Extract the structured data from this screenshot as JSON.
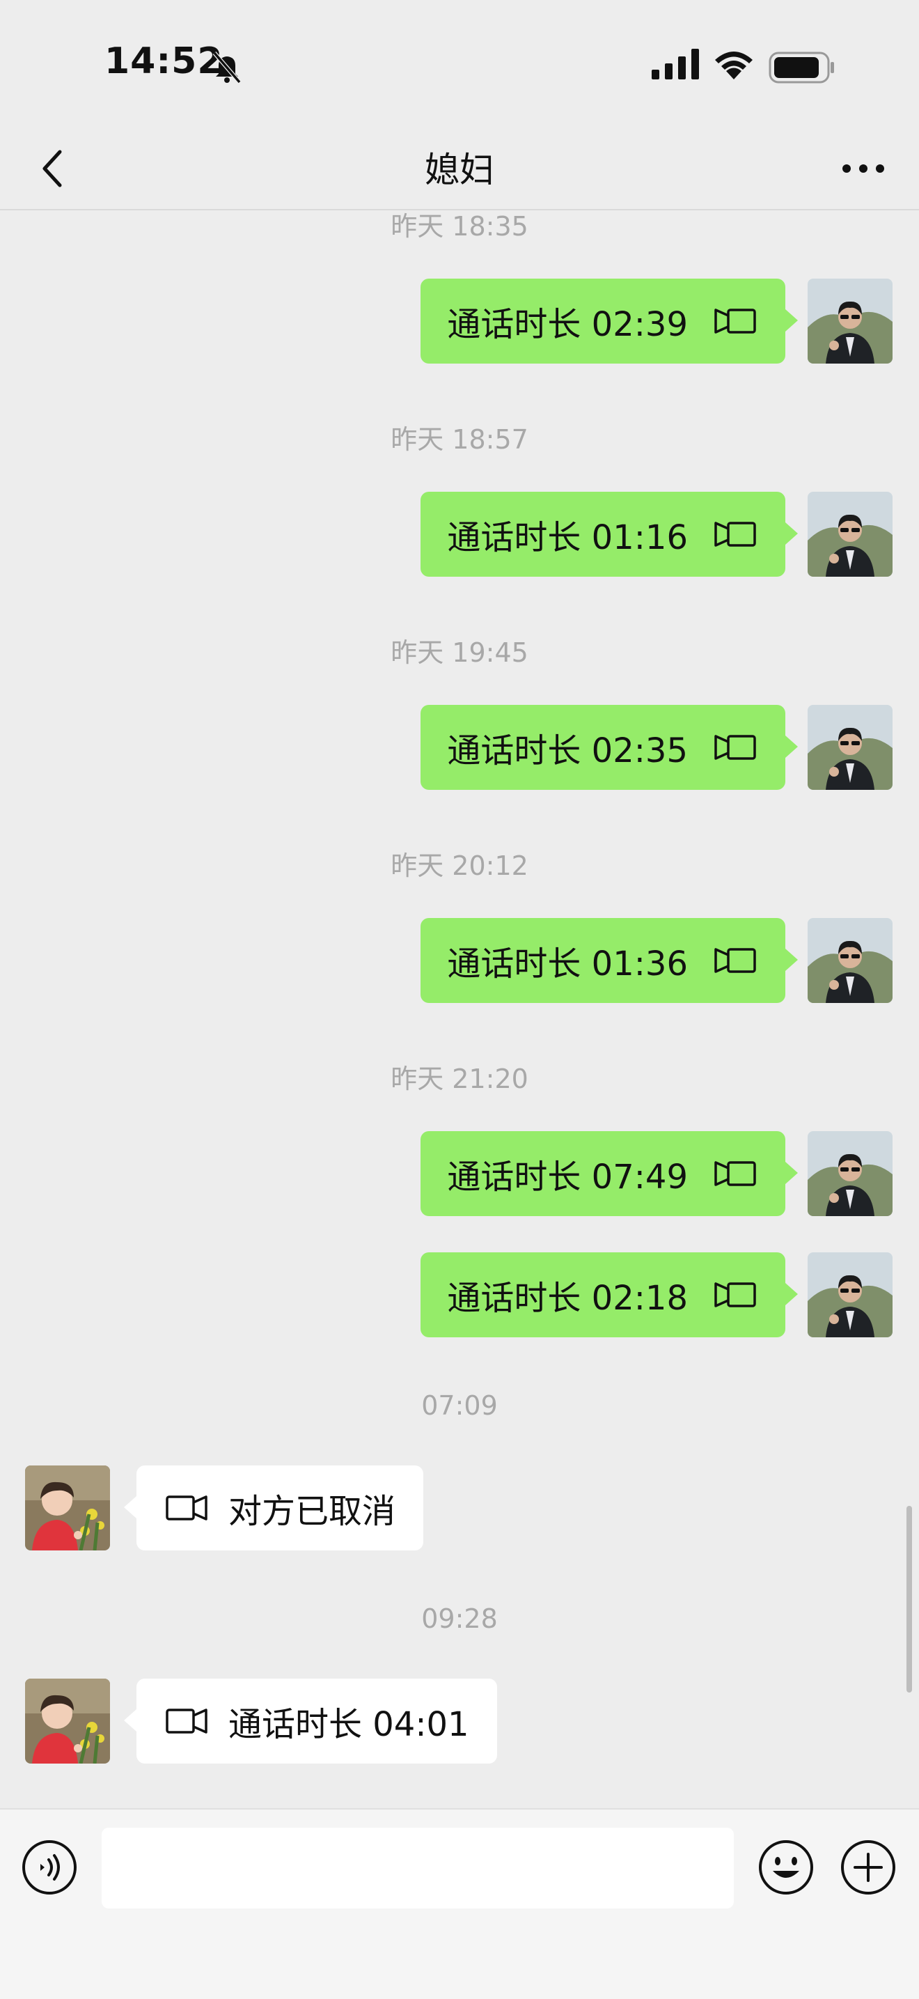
{
  "status_bar": {
    "time": "14:52"
  },
  "header": {
    "title": "媳妇"
  },
  "messages": [
    {
      "timestamp": "昨天 18:35",
      "bubbles": [
        "通话时长 02:39"
      ]
    },
    {
      "timestamp": "昨天 18:57",
      "bubbles": [
        "通话时长 01:16"
      ]
    },
    {
      "timestamp": "昨天 19:45",
      "bubbles": [
        "通话时长 02:35"
      ]
    },
    {
      "timestamp": "昨天 20:12",
      "bubbles": [
        "通话时长 01:36"
      ]
    },
    {
      "timestamp": "昨天 21:20",
      "bubbles": [
        "通话时长 07:49",
        "通话时长 02:18"
      ]
    },
    {
      "timestamp": "07:09",
      "bubbles": [
        "对方已取消"
      ]
    },
    {
      "timestamp": "09:28",
      "bubbles": [
        "通话时长 04:01"
      ]
    }
  ],
  "colors": {
    "outgoing_bubble": "#95ec69",
    "incoming_bubble": "#ffffff",
    "chat_background": "#ededed"
  }
}
